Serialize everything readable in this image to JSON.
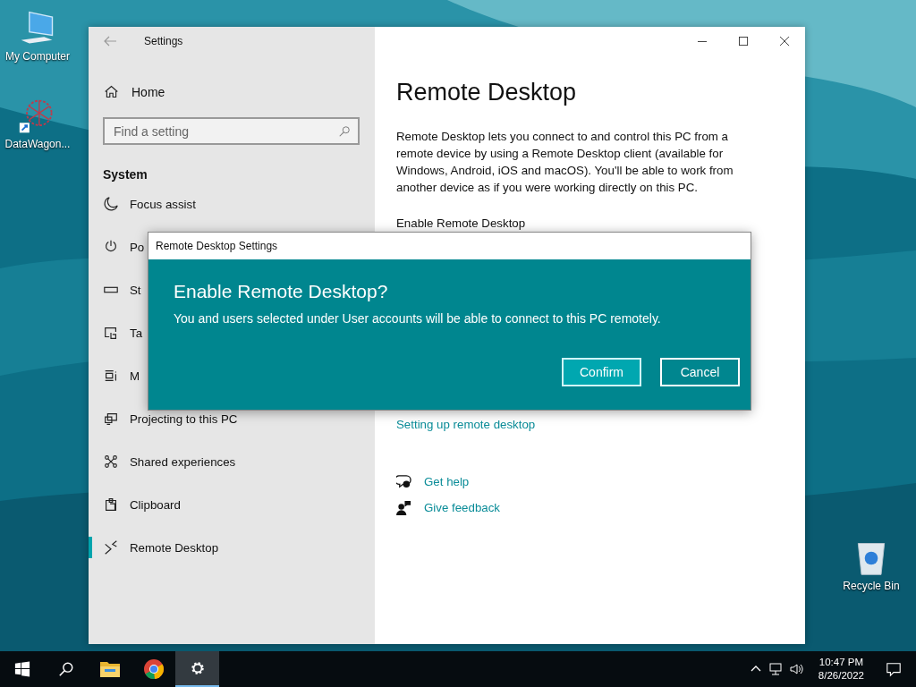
{
  "desktop_icons": [
    {
      "label": "My Computer"
    },
    {
      "label": "DataWagon..."
    },
    {
      "label": "Recycle Bin"
    }
  ],
  "settings_window": {
    "title": "Settings",
    "nav": {
      "home": "Home",
      "search": {
        "placeholder": "Find a setting"
      },
      "section": "System",
      "items": [
        {
          "label": "Focus assist",
          "selected": false
        },
        {
          "label": "Po",
          "selected": false
        },
        {
          "label": "St",
          "selected": false
        },
        {
          "label": "Ta",
          "selected": false
        },
        {
          "label": "M",
          "selected": false
        },
        {
          "label": "Projecting to this PC",
          "selected": false
        },
        {
          "label": "Shared experiences",
          "selected": false
        },
        {
          "label": "Clipboard",
          "selected": false
        },
        {
          "label": "Remote Desktop",
          "selected": true
        }
      ]
    },
    "page": {
      "title": "Remote Desktop",
      "description": "Remote Desktop lets you connect to and control this PC from a remote device by using a Remote Desktop client (available for Windows, Android, iOS and macOS). You'll be able to work from another device as if you were working directly on this PC.",
      "toggle_label": "Enable Remote Desktop",
      "link": "Setting up remote desktop",
      "help_links": [
        {
          "label": "Get help"
        },
        {
          "label": "Give feedback"
        }
      ]
    }
  },
  "dialog": {
    "title": "Remote Desktop Settings",
    "heading": "Enable Remote Desktop?",
    "message": "You and users selected under User accounts will be able to connect to this PC remotely.",
    "buttons": [
      {
        "label": "Confirm",
        "kind": "primary"
      },
      {
        "label": "Cancel",
        "kind": "secondary"
      }
    ]
  },
  "taskbar": {
    "apps": [
      {
        "selected": false
      },
      {
        "selected": false
      },
      {
        "selected": false
      },
      {
        "selected": false
      },
      {
        "selected": true
      }
    ],
    "time": "10:47 PM",
    "date": "8/26/2022"
  }
}
